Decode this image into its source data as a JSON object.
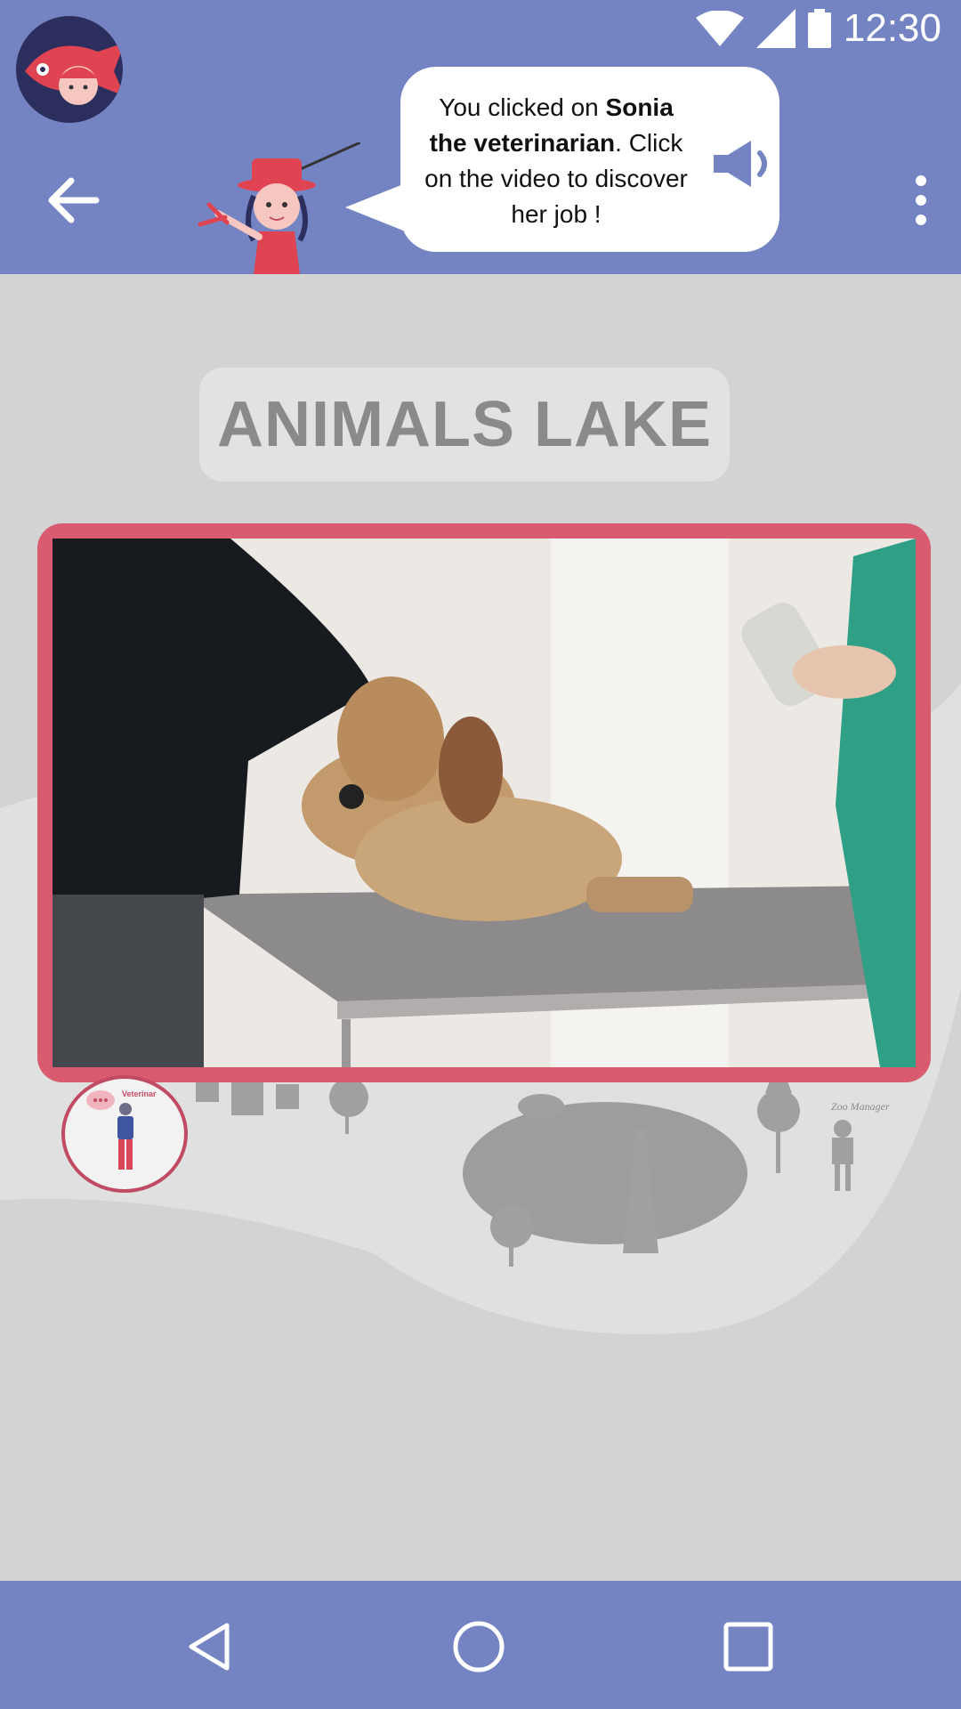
{
  "status_bar": {
    "time": "12:30"
  },
  "app_bar": {
    "bubble_prefix": "You clicked on ",
    "bubble_name": "Sonia the veterinarian",
    "bubble_period": ".",
    "bubble_instruction": "Click on the video to discover her job !"
  },
  "map": {
    "title": "ANIMALS LAKE",
    "character_thumb_label": "Veterinar",
    "zoo_label": "Zoo Manager"
  },
  "colors": {
    "primary": "#7484c2",
    "accent": "#d85b6f",
    "background": "#d3d3d3"
  },
  "nav_bar": {
    "buttons": [
      "back",
      "home",
      "recents"
    ]
  }
}
